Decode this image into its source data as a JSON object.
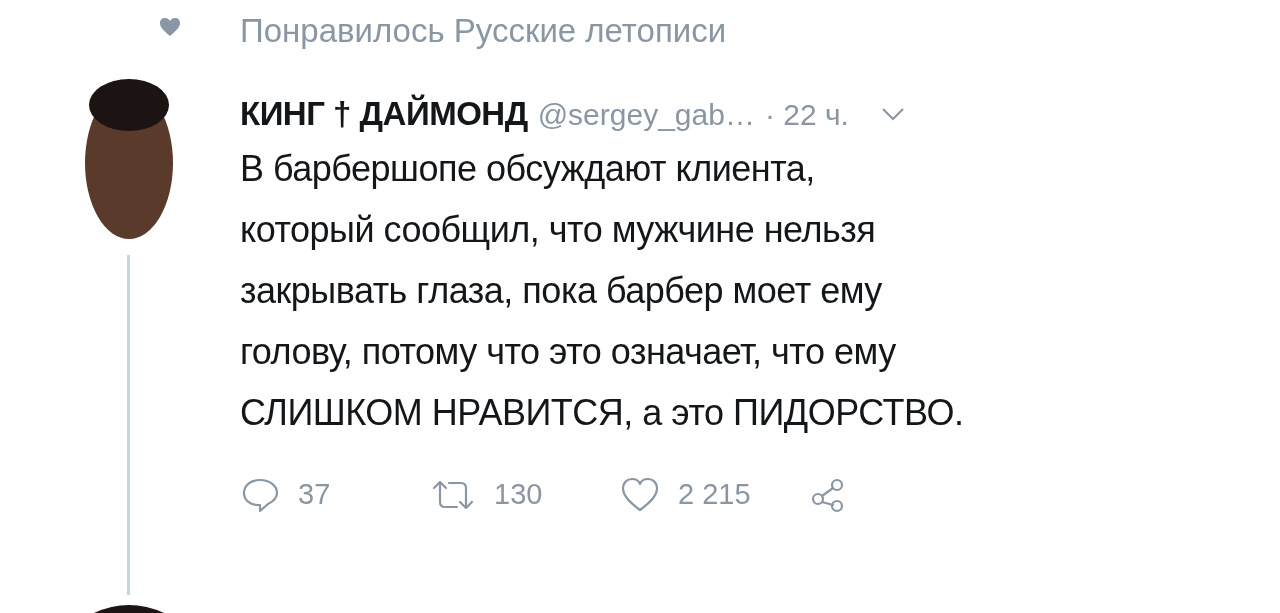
{
  "social_context": {
    "text": "Понравилось Русские летописи"
  },
  "tweet": {
    "name": "КИНГ † ДАЙМОНД",
    "handle": "@sergey_gab…",
    "time": "· 22 ч.",
    "body_lines": [
      "В барбершопе обсуждают клиента,",
      "который сообщил, что мужчине нельзя",
      "закрывать глаза, пока барбер моет ему",
      "голову, потому что это означает, что ему",
      "СЛИШКОМ НРАВИТСЯ, а это ПИДОРСТВО."
    ],
    "actions": [
      {
        "kind": "reply",
        "count": "37"
      },
      {
        "kind": "retweet",
        "count": "130"
      },
      {
        "kind": "like",
        "count": "2 215"
      },
      {
        "kind": "share"
      }
    ]
  }
}
